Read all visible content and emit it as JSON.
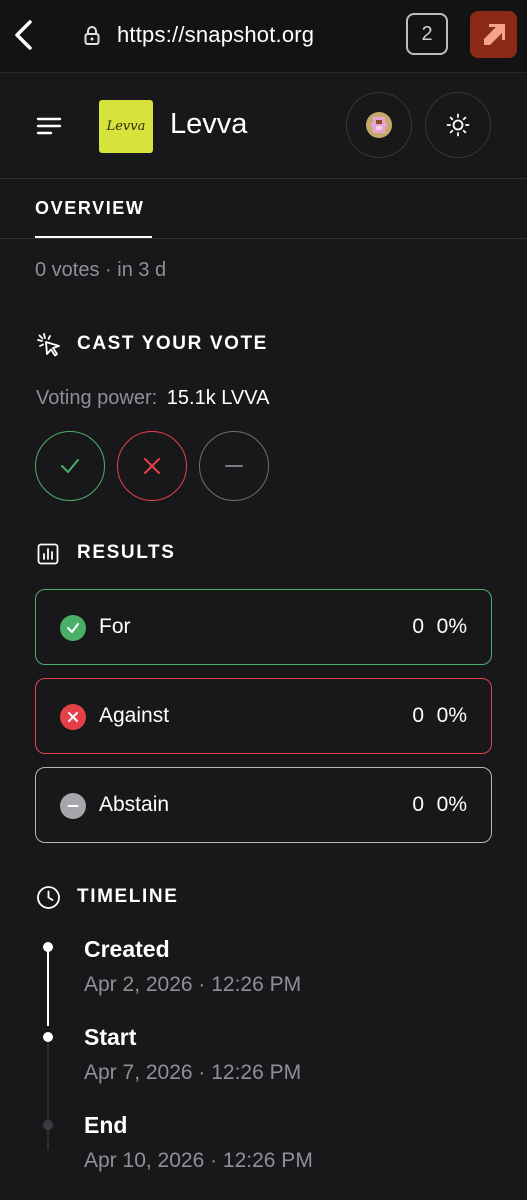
{
  "browser": {
    "url": "https://snapshot.org",
    "tab_count": "2"
  },
  "space": {
    "logo_text": "Levva",
    "name": "Levva"
  },
  "tabs": [
    {
      "label": "OVERVIEW"
    }
  ],
  "summary": "0 votes · in 3 d",
  "cast_vote": {
    "title": "CAST YOUR VOTE",
    "voting_power_label": "Voting power:",
    "voting_power_value": "15.1k LVVA"
  },
  "results": {
    "title": "RESULTS",
    "items": [
      {
        "label": "For",
        "count": "0",
        "percent": "0%",
        "color": "#4caf67"
      },
      {
        "label": "Against",
        "count": "0",
        "percent": "0%",
        "color": "#e5404a"
      },
      {
        "label": "Abstain",
        "count": "0",
        "percent": "0%",
        "color": "#a6a6ab"
      }
    ]
  },
  "timeline": {
    "title": "TIMELINE",
    "events": [
      {
        "label": "Created",
        "date": "Apr 2, 2026 · 12:26 PM"
      },
      {
        "label": "Start",
        "date": "Apr 7, 2026 · 12:26 PM"
      },
      {
        "label": "End",
        "date": "Apr 10, 2026 · 12:26 PM"
      }
    ]
  },
  "colors": {
    "background": "#18181b",
    "for": "#4caf67",
    "against": "#e5404a",
    "abstain": "#8e8e93"
  },
  "icons": [
    "back-arrow-icon",
    "lock-icon",
    "external-link-icon",
    "menu-icon",
    "avatar-icon",
    "sun-icon",
    "cursor-click-icon",
    "bar-chart-icon",
    "check-icon",
    "x-icon",
    "minus-icon",
    "clock-icon"
  ]
}
